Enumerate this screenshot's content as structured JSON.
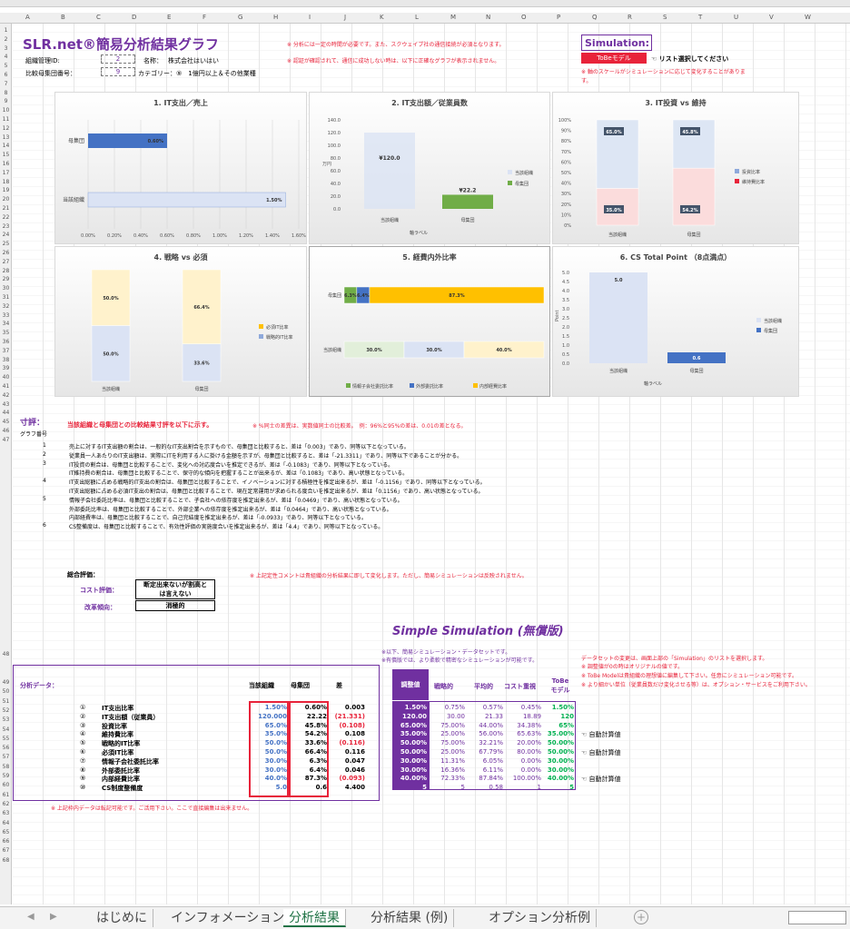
{
  "header": {
    "title": "SLR.net®簡易分析結果グラフ",
    "note1": "※  分析には一定の時間が必要です。また、スクウェイブ社の通信接続が必須となります。",
    "note2": "※  認証が確認されて、通信に成功しない時は、以下に正確なグラフが表示されません。",
    "org_id_label": "組織管理ID:",
    "org_id": "2",
    "name_label": "名称：",
    "name": "株式会社はいはい",
    "group_label": "比較母集団番号：",
    "group_no": "9",
    "category_label": "カテゴリー：⑨　1億円以上＆その他業種"
  },
  "simulation": {
    "label": "Simulation:",
    "selected": "ToBeモデル",
    "pick_note": "☜  リスト選択してください",
    "scale_note": "※  軸のスケールがシミュレーションに応じて変化することがありま",
    "scale_note2": "す。"
  },
  "charts": [
    {
      "title": "1. IT支出／売上",
      "type": "bar",
      "categories": [
        "母集団",
        "当該組織"
      ],
      "values": [
        0.6,
        1.5
      ],
      "labels": [
        "0.60%",
        "1.50%"
      ],
      "xticks": [
        "0.00%",
        "0.20%",
        "0.40%",
        "0.60%",
        "0.80%",
        "1.00%",
        "1.20%",
        "1.40%",
        "1.60%"
      ]
    },
    {
      "title": "2. IT支出額／従業員数",
      "type": "bar",
      "categories": [
        "当該組織",
        "母集団"
      ],
      "values": [
        120.0,
        22.2
      ],
      "labels": [
        "¥120.0",
        "¥22.2"
      ],
      "yticks": [
        "140.0",
        "120.0",
        "100.0",
        "80.0",
        "60.0",
        "40.0",
        "20.0",
        "0.0"
      ],
      "ylabel": "万円",
      "xlabel": "軸ラベル",
      "legend": [
        "当該組織",
        "母集団"
      ]
    },
    {
      "title": "3. IT投資 vs 維持",
      "type": "stacked",
      "categories": [
        "当該組織",
        "母集団"
      ],
      "series": [
        {
          "name": "維持費比率",
          "values": [
            35.0,
            54.2
          ]
        },
        {
          "name": "投資比率",
          "values": [
            65.0,
            45.8
          ]
        }
      ],
      "yticks": [
        "100%",
        "90%",
        "80%",
        "70%",
        "60%",
        "50%",
        "40%",
        "30%",
        "20%",
        "10%",
        "0%"
      ],
      "labels": [
        [
          "35.0%",
          "65.0%"
        ],
        [
          "54.2%",
          "45.8%"
        ]
      ]
    },
    {
      "title": "4. 戦略 vs 必須",
      "type": "stacked",
      "categories": [
        "当該組織",
        "母集団"
      ],
      "series": [
        {
          "name": "戦略的IT比率",
          "values": [
            50.0,
            33.6
          ]
        },
        {
          "name": "必須IT比率",
          "values": [
            50.0,
            66.4
          ]
        }
      ],
      "labels": [
        [
          "50.0%",
          "50.0%"
        ],
        [
          "33.6%",
          "66.4%"
        ]
      ]
    },
    {
      "title": "5. 経費内外比率",
      "type": "stackedbar",
      "categories": [
        "母集団",
        "当該組織"
      ],
      "series": [
        {
          "name": "情報子会社委託比率",
          "values": [
            6.3,
            30.0
          ]
        },
        {
          "name": "外部委託比率",
          "values": [
            6.4,
            30.0
          ]
        },
        {
          "name": "内部経費比率",
          "values": [
            87.3,
            40.0
          ]
        }
      ],
      "labels": [
        [
          "6.3%",
          "6.4%",
          "87.3%"
        ],
        [
          "30.0%",
          "30.0%",
          "40.0%"
        ]
      ]
    },
    {
      "title": "6. CS Total Point （8点満点）",
      "type": "bar",
      "categories": [
        "当該組織",
        "母集団"
      ],
      "values": [
        5.0,
        0.6
      ],
      "labels": [
        "5.0",
        "0.6"
      ],
      "yticks": [
        "5.0",
        "4.5",
        "4.0",
        "3.5",
        "3.0",
        "2.5",
        "2.0",
        "1.5",
        "1.0",
        "0.5",
        "0.0"
      ],
      "ylabel": "Point",
      "xlabel": "軸ラベル",
      "legend": [
        "当該組織",
        "母集団"
      ]
    }
  ],
  "review": {
    "label": "寸評：",
    "sub": "グラフ番号",
    "intro": "当該組織と母集団との比較結果寸評を以下に示す。",
    "note": "※  %同士の差異は、実数値同士の比較差。　例：96%と95%の差は、0.01の差となる。",
    "rows": [
      {
        "n": "1",
        "text": "売上に対するIT支出額の割合は、一般的なIT支出割合を示すもので、母集団と比較すると、差は「0.003」であり、同等以下となっている。"
      },
      {
        "n": "2",
        "text": "従業員一人あたりのIT支出額は、実際にITを利用する人に掛ける金額を示すが、母集団と比較すると、差は「-21.3311」であり、同等以下であることが分かる。"
      },
      {
        "n": "3",
        "text": "IT投資の割合は、母集団と比較することで、変化への対応度合いを推定できるが、差は「-0.1083」であり、同等以下となっている。"
      },
      {
        "n": "",
        "text": "IT維持費の割合は、母集団と比較することで、保守的な傾向を把握することが出来るが、差は「0.1083」であり、高い状態となっている。"
      },
      {
        "n": "4",
        "text": "IT支出総額に占める戦略的IT支出の割合は、母集団と比較することで、イノベーションに対する積極性を推定出来るが、差は「-0.1156」であり、同等以下となっている。"
      },
      {
        "n": "",
        "text": "IT支出総額に占める必須IT支出の割合は、母集団と比較することで、現在定常運用が求められる度合いを推定出来るが、差は「0.1156」であり、高い状態となっている。"
      },
      {
        "n": "5",
        "text": "情報子会社委託比率は、母集団と比較することで、子会社への依存度を推定出来るが、差は「0.0469」であり、高い状態となっている。"
      },
      {
        "n": "",
        "text": "外部委託比率は、母集団と比較することで、外部企業への依存度を推定出来るが、差は「0.0464」であり、高い状態となっている。"
      },
      {
        "n": "",
        "text": "内部経費率は、母集団と比較することで、自己完結度を推定出来るが、差は「-0.0933」であり、同等以下となっている。"
      },
      {
        "n": "6",
        "text": "CS整備度は、母集団と比較することで、有効性評価の実施度合いを推定出来るが、差は「4.4」であり、同等以下となっている。"
      }
    ]
  },
  "overall": {
    "label": "総合評価：",
    "note": "※  上記定性コメントは貴組織の分析結果に即して変化します。ただし、簡易シミュレーションは反映されません。",
    "cost_label": "コスト評価：",
    "cost_value1": "断定出来ないが割高と",
    "cost_value2": "は言えない",
    "trend_label": "改革傾向：",
    "trend_value": "消極的"
  },
  "simple": {
    "title": "Simple Simulation (無償版)",
    "note1": "※以下、簡易シミュレーション・データセットです。",
    "note2": "※有償版では、より柔軟で精密なシミュレーションが可能です。",
    "rnote1": "データセットの変更は、画面上部の「Simulation」のリストを選択します。",
    "rnote2": "※  調整値が0の時はオリジナルの値です。",
    "rnote3": "※  ToBe Modelは貴組織の理想値に編集して下さい。任意にシミュレーション可能です。",
    "rnote4": "※  より細かい単位（従業員数だけ変化させる等）は、オプション・サービスをご利用下さい。",
    "headers": [
      "調整値",
      "戦略的",
      "平均的",
      "コスト重視",
      "ToBe モデル"
    ]
  },
  "analysis": {
    "label": "分析データ：",
    "headers": [
      "当該組織",
      "母集団",
      "差"
    ],
    "rows": [
      {
        "no": "①",
        "name": "IT支出比率",
        "org": "1.50%",
        "pop": "0.60%",
        "diff": "0.003",
        "adj": "1.50%",
        "s": "0.75%",
        "a": "0.57%",
        "c": "0.45%",
        "tobe": "1.50%",
        "auto": ""
      },
      {
        "no": "②",
        "name": "IT支出額（従業員）",
        "org": "120.000",
        "pop": "22.22",
        "diff": "(21.331)",
        "adj": "120.00",
        "s": "30.00",
        "a": "21.33",
        "c": "18.89",
        "tobe": "120",
        "auto": ""
      },
      {
        "no": "③",
        "name": "投資比率",
        "org": "65.0%",
        "pop": "45.8%",
        "diff": "(0.108)",
        "adj": "65.00%",
        "s": "75.00%",
        "a": "44.00%",
        "c": "34.38%",
        "tobe": "65%",
        "auto": ""
      },
      {
        "no": "④",
        "name": "維持費比率",
        "org": "35.0%",
        "pop": "54.2%",
        "diff": "0.108",
        "adj": "35.00%",
        "s": "25.00%",
        "a": "56.00%",
        "c": "65.63%",
        "tobe": "35.00%",
        "auto": "☜  自動計算値"
      },
      {
        "no": "⑤",
        "name": "戦略的IT比率",
        "org": "50.0%",
        "pop": "33.6%",
        "diff": "(0.116)",
        "adj": "50.00%",
        "s": "75.00%",
        "a": "32.21%",
        "c": "20.00%",
        "tobe": "50.00%",
        "auto": ""
      },
      {
        "no": "⑥",
        "name": "必須IT比率",
        "org": "50.0%",
        "pop": "66.4%",
        "diff": "0.116",
        "adj": "50.00%",
        "s": "25.00%",
        "a": "67.79%",
        "c": "80.00%",
        "tobe": "50.00%",
        "auto": "☜  自動計算値"
      },
      {
        "no": "⑦",
        "name": "情報子会社委託比率",
        "org": "30.0%",
        "pop": "6.3%",
        "diff": "0.047",
        "adj": "30.00%",
        "s": "11.31%",
        "a": "6.05%",
        "c": "0.00%",
        "tobe": "30.00%",
        "auto": ""
      },
      {
        "no": "⑧",
        "name": "外部委託比率",
        "org": "30.0%",
        "pop": "6.4%",
        "diff": "0.046",
        "adj": "30.00%",
        "s": "16.36%",
        "a": "6.11%",
        "c": "0.00%",
        "tobe": "30.00%",
        "auto": ""
      },
      {
        "no": "⑨",
        "name": "内部経費比率",
        "org": "40.0%",
        "pop": "87.3%",
        "diff": "(0.093)",
        "adj": "40.00%",
        "s": "72.33%",
        "a": "87.84%",
        "c": "100.00%",
        "tobe": "40.00%",
        "auto": "☜  自動計算値"
      },
      {
        "no": "⑩",
        "name": "CS制度整備度",
        "org": "5.0",
        "pop": "0.6",
        "diff": "4.400",
        "adj": "5",
        "s": "5",
        "a": "0.58",
        "c": "1",
        "tobe": "5",
        "auto": ""
      }
    ],
    "footnote": "※  上記枠内データは転記可能です。ご活用下さい。ここで直接編集は出来ません。"
  },
  "tabs": [
    "はじめに",
    "インフォメーション",
    "分析結果",
    "分析結果 (例)",
    "オプション分析例"
  ],
  "columns": [
    "A",
    "B",
    "C",
    "D",
    "E",
    "F",
    "G",
    "H",
    "I",
    "J",
    "K",
    "L",
    "M",
    "N",
    "O",
    "P",
    "Q",
    "R",
    "S",
    "T",
    "U",
    "V",
    "W"
  ]
}
